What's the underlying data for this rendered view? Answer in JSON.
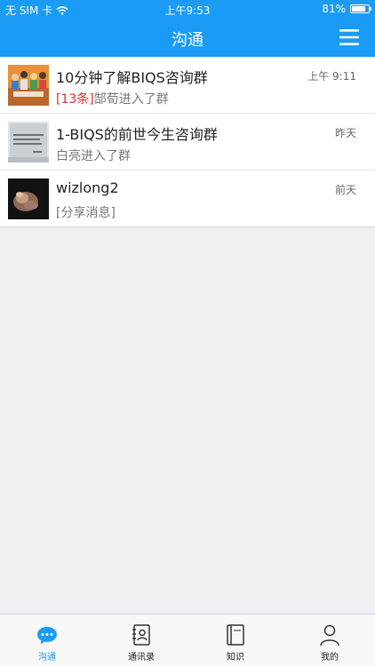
{
  "status_bar": {
    "carrier": "无 SIM 卡",
    "time": "上午9:53",
    "battery_text": "81%",
    "battery_level": 0.81
  },
  "nav": {
    "title": "沟通",
    "menu_icon": "menu-icon"
  },
  "chats": [
    {
      "title": "10分钟了解BIQS咨询群",
      "time": "上午 9:11",
      "unread_badge": "[13条]",
      "preview": "郜荀进入了群",
      "avatar": "group-photo-avatar"
    },
    {
      "title": "1-BIQS的前世今生咨询群",
      "time": "昨天",
      "preview": "白亮进入了群",
      "avatar": "slide-thumbnail-avatar"
    },
    {
      "title": "wizlong2",
      "time": "前天",
      "preview": "[分享消息]",
      "avatar": "hand-photo-avatar"
    }
  ],
  "tabs": [
    {
      "label": "沟通",
      "icon": "chat-bubble-icon",
      "active": true
    },
    {
      "label": "通讯录",
      "icon": "contacts-book-icon",
      "active": false
    },
    {
      "label": "知识",
      "icon": "book-icon",
      "active": false
    },
    {
      "label": "我的",
      "icon": "person-icon",
      "active": false
    }
  ],
  "colors": {
    "primary": "#1a9bf5",
    "unread": "#d9322b",
    "background": "#efeff4"
  }
}
